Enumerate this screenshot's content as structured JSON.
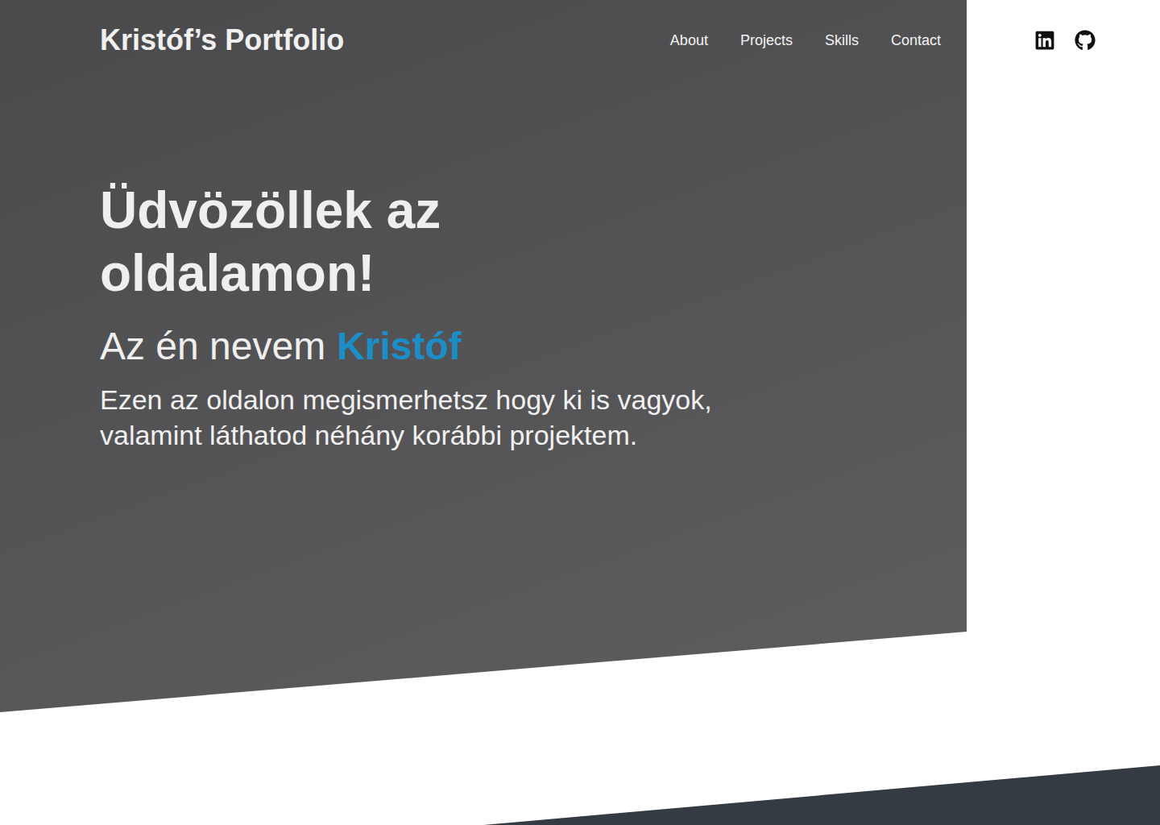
{
  "header": {
    "title": "Kristóf’s Portfolio",
    "nav": [
      {
        "label": "About"
      },
      {
        "label": "Projects"
      },
      {
        "label": "Skills"
      },
      {
        "label": "Contact"
      }
    ]
  },
  "hero": {
    "heading": "Üdvözöllek az oldalamon!",
    "name_prefix": "Az én nevem",
    "name": "Kristóf",
    "intro": "Ezen az oldalon megismerhetsz hogy ki is vagyok, valamint láthatod néhány korábbi projektem."
  }
}
